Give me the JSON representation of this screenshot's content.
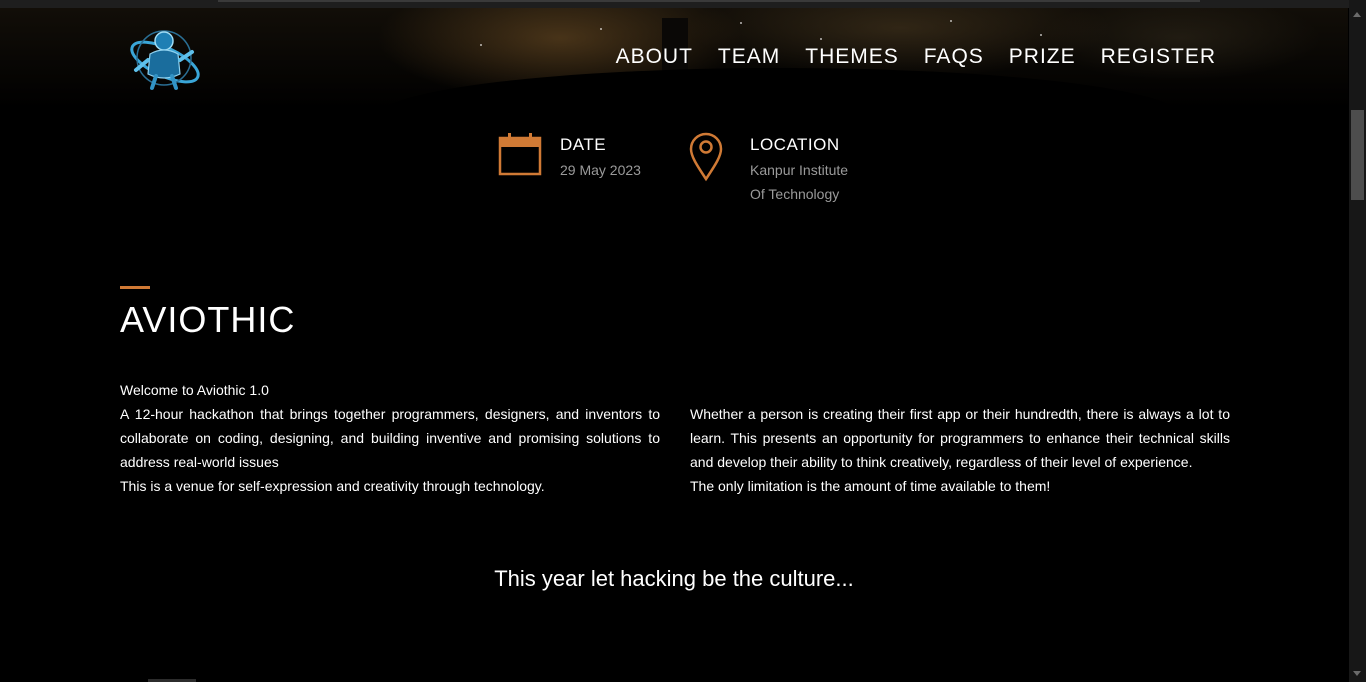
{
  "nav": {
    "items": [
      {
        "label": "ABOUT"
      },
      {
        "label": "TEAM"
      },
      {
        "label": "THEMES"
      },
      {
        "label": "FAQS"
      },
      {
        "label": "PRIZE"
      },
      {
        "label": "REGISTER"
      }
    ]
  },
  "logo": {
    "icon": "astronaut-logo"
  },
  "info": {
    "date": {
      "title": "DATE",
      "value": "29 May 2023",
      "icon": "calendar-icon"
    },
    "location": {
      "title": "LOCATION",
      "line1": "Kanpur Institute",
      "line2": "Of Technology",
      "icon": "map-pin-icon"
    }
  },
  "about": {
    "title": "AVIOTHIC",
    "left": {
      "p1": "Welcome to Aviothic 1.0",
      "p2": "A 12-hour hackathon that brings together programmers, designers, and inventors to collaborate on coding, designing, and building inventive and promising solutions to address real-world issues",
      "p3": "This is a venue for self-expression and creativity through technology."
    },
    "right": {
      "p1": "Whether a person is creating their first app or their hundredth, there is always a lot to learn. This presents an opportunity for programmers to enhance their technical skills and develop their ability to think creatively, regardless of their level of experience.",
      "p2": "The only limitation is the amount of time available to them!"
    }
  },
  "tagline": "This year let hacking be the culture...",
  "colors": {
    "accent": "#d07a35",
    "background": "#000000",
    "muted_text": "#9a9a9a"
  }
}
